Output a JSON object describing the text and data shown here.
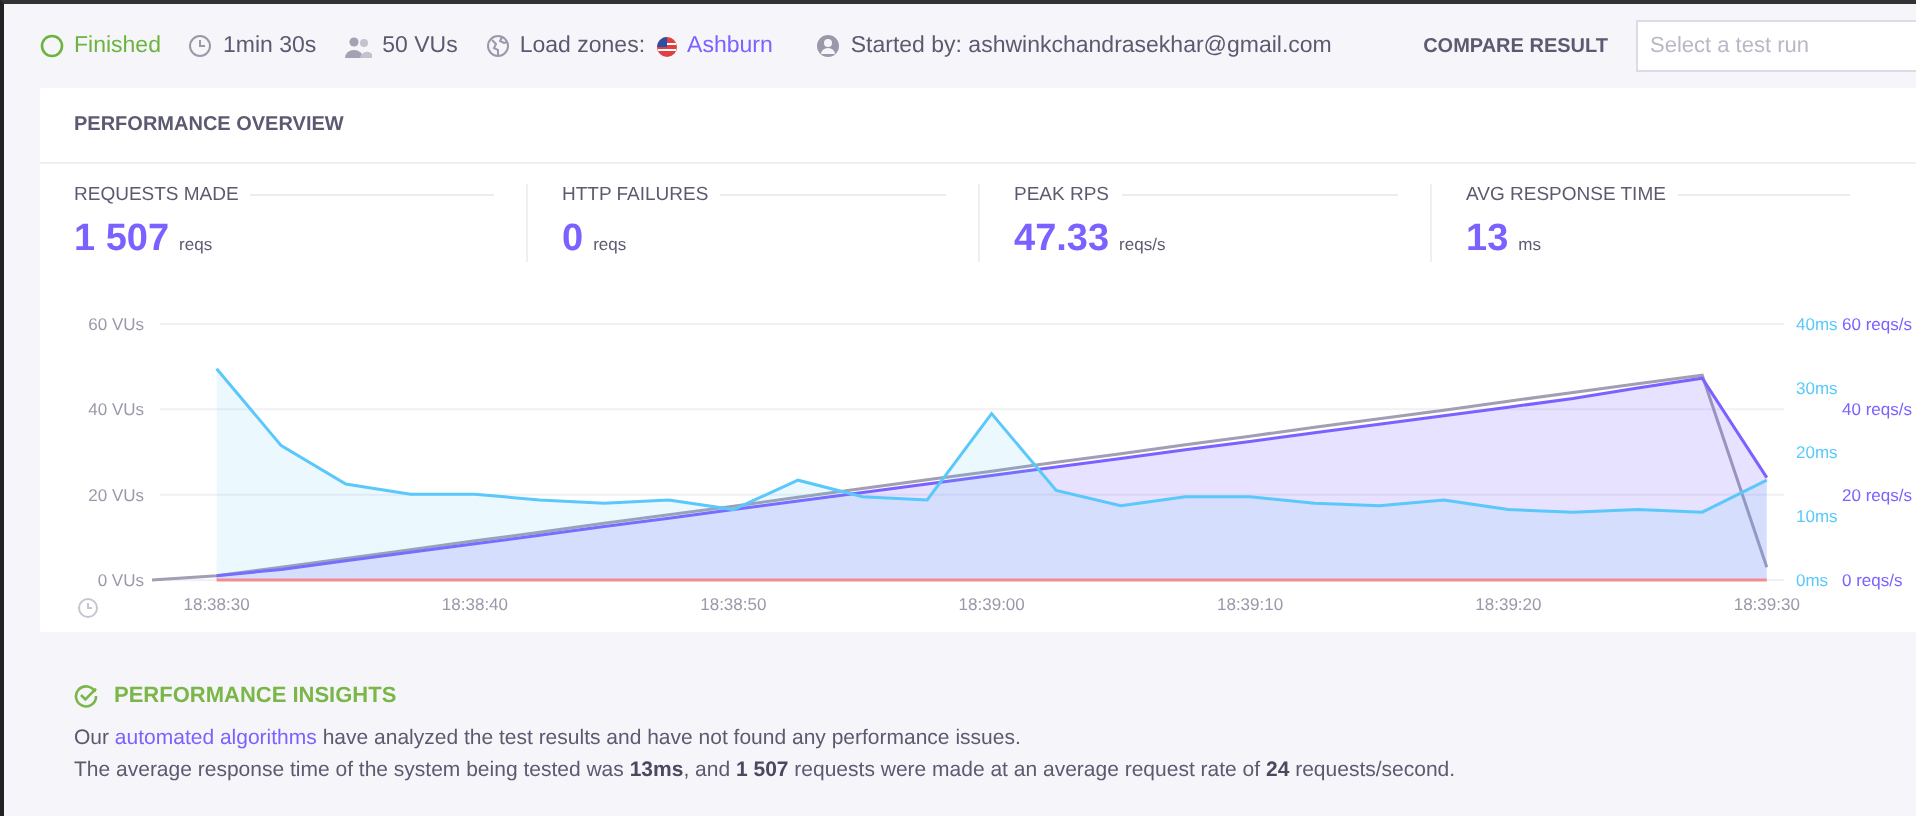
{
  "status_bar": {
    "status": "Finished",
    "duration": "1min 30s",
    "vus": "50 VUs",
    "load_zones_label": "Load zones:",
    "load_zone": "Ashburn",
    "started_by": "Started by: ashwinkchandrasekhar@gmail.com",
    "compare_label": "COMPARE RESULT",
    "compare_field": {
      "placeholder": "Select a test run"
    }
  },
  "overview": {
    "title": "PERFORMANCE OVERVIEW",
    "metrics": [
      {
        "label": "REQUESTS MADE",
        "value": "1 507",
        "unit": "reqs"
      },
      {
        "label": "HTTP FAILURES",
        "value": "0",
        "unit": "reqs"
      },
      {
        "label": "PEAK RPS",
        "value": "47.33",
        "unit": "reqs/s"
      },
      {
        "label": "AVG RESPONSE TIME",
        "value": "13",
        "unit": "ms"
      }
    ],
    "chart_data": {
      "type": "line",
      "categories": [
        null,
        "18:38:30",
        null,
        null,
        null,
        "18:38:40",
        null,
        null,
        null,
        "18:38:50",
        null,
        null,
        null,
        "18:39:00",
        null,
        null,
        null,
        "18:39:10",
        null,
        null,
        null,
        "18:39:20",
        null,
        null,
        null,
        "18:39:30"
      ],
      "ylim": [
        0,
        60
      ],
      "yticks": [
        {
          "value": 0,
          "label": "0 VUs"
        },
        {
          "value": 20,
          "label": "20 VUs"
        },
        {
          "value": 40,
          "label": "40 VUs"
        },
        {
          "value": 60,
          "label": "60 VUs"
        }
      ],
      "y2lim": [
        0,
        40
      ],
      "y3lim": [
        0,
        60
      ],
      "y2ticks": [
        {
          "value": 0,
          "label": "0ms"
        },
        {
          "value": 10,
          "label": "10ms"
        },
        {
          "value": 20,
          "label": "20ms"
        },
        {
          "value": 30,
          "label": "30ms"
        },
        {
          "value": 40,
          "label": "40ms"
        }
      ],
      "y3ticks": [
        {
          "value": 0,
          "label": "0 reqs/s"
        },
        {
          "value": 20,
          "label": "20 reqs/s"
        },
        {
          "value": 40,
          "label": "40 reqs/s"
        },
        {
          "value": 60,
          "label": "60 reqs/s"
        }
      ],
      "series": [
        {
          "color": "#a09fb3",
          "values": [
            0,
            1,
            3,
            5,
            7.1,
            9.2,
            11.2,
            13.3,
            15.3,
            17.3,
            19.4,
            21.4,
            23.5,
            25.5,
            27.6,
            29.6,
            31.7,
            33.7,
            35.8,
            37.8,
            39.8,
            41.9,
            43.9,
            46,
            48,
            3
          ]
        },
        {
          "color": "#7b61ff",
          "type": "area",
          "axis": "y3",
          "values": [
            null,
            1,
            2.5,
            4.5,
            6.5,
            8.5,
            10.5,
            12.5,
            14.5,
            16.5,
            18.5,
            20.5,
            22.5,
            24.5,
            26.5,
            28.5,
            30.5,
            32.5,
            34.5,
            36.5,
            38.5,
            40.5,
            42.5,
            45,
            47.3,
            24
          ]
        },
        {
          "color": "#5ac8fa",
          "type": "area",
          "axis": "y2",
          "values": [
            null,
            33,
            21,
            15,
            13.4,
            13.4,
            12.5,
            12,
            12.5,
            11,
            15.6,
            13,
            12.5,
            26,
            14,
            11.6,
            13,
            13,
            12,
            11.6,
            12.5,
            11,
            10.6,
            11,
            10.6,
            15.6
          ]
        },
        {
          "color": "#f28b96",
          "values": [
            null,
            0,
            0,
            0,
            0,
            0,
            0,
            0,
            0,
            0,
            0,
            0,
            0,
            0,
            0,
            0,
            0,
            0,
            0,
            0,
            0,
            0,
            0,
            0,
            0,
            0
          ]
        }
      ]
    }
  },
  "insights": {
    "title": "PERFORMANCE INSIGHTS",
    "summary": [
      {
        "kind": "text",
        "text": "Our "
      },
      {
        "kind": "link",
        "text": "automated algorithms"
      },
      {
        "kind": "text",
        "text": " have analyzed the test results and have not found any performance issues."
      }
    ],
    "detail": "The average response time of the system being tested was **13ms**, and **1 507** requests were made at an average request rate of **24** requests/second."
  }
}
